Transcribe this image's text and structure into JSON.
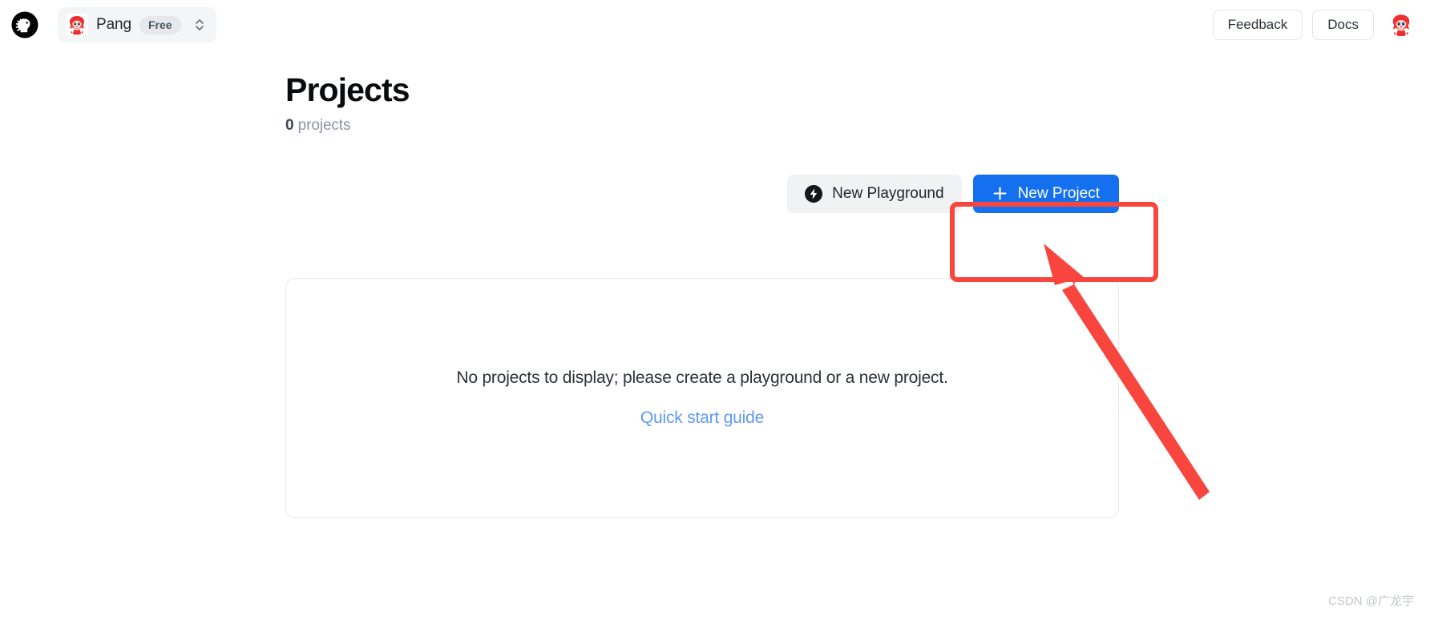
{
  "header": {
    "logo_icon": "neon-logo-icon",
    "org": {
      "avatar_icon": "org-avatar",
      "name": "Pang",
      "plan_badge": "Free",
      "chevron_icon": "chevron-up-down-icon"
    },
    "feedback_label": "Feedback",
    "docs_label": "Docs",
    "user_avatar_icon": "user-avatar"
  },
  "page": {
    "title": "Projects",
    "subtitle_count": "0",
    "subtitle_label": "projects"
  },
  "actions": {
    "playground_label": "New Playground",
    "playground_icon": "lightning-bolt-icon",
    "new_project_label": "New Project",
    "new_project_icon": "plus-icon"
  },
  "empty_state": {
    "message": "No projects to display; please create a playground or a new project.",
    "link_label": "Quick start guide"
  },
  "annotations": {
    "highlight_color": "#f8463f",
    "arrow_icon": "red-arrow-icon",
    "box_icon": "red-highlight-box"
  },
  "watermark": {
    "text": "CSDN @广龙宇"
  },
  "colors": {
    "primary_button": "#1570ef",
    "link": "#5e9bf0",
    "annotation": "#f8463f"
  }
}
